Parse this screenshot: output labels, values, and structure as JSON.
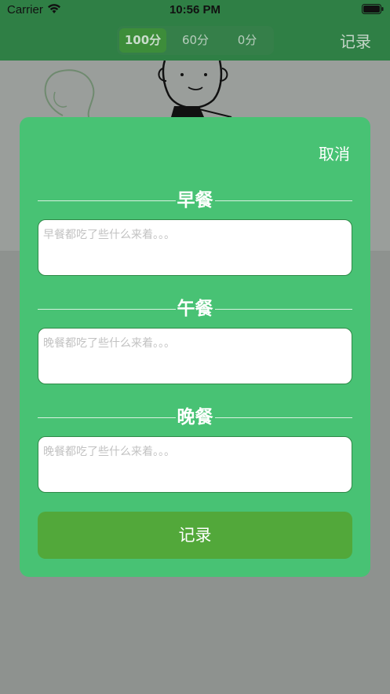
{
  "status_bar": {
    "carrier": "Carrier",
    "time": "10:56 PM",
    "icons": [
      "wifi-icon",
      "battery-icon"
    ]
  },
  "nav": {
    "segments": [
      {
        "label": "100分",
        "selected": true
      },
      {
        "label": "60分",
        "selected": false
      },
      {
        "label": "0分",
        "selected": false
      }
    ],
    "record_label": "记录"
  },
  "modal": {
    "cancel_label": "取消",
    "meals": [
      {
        "title": "早餐",
        "placeholder": "早餐都吃了些什么来着。。。",
        "value": ""
      },
      {
        "title": "午餐",
        "placeholder": "晚餐都吃了些什么来着。。。",
        "value": ""
      },
      {
        "title": "晚餐",
        "placeholder": "晚餐都吃了些什么来着。。。",
        "value": ""
      }
    ],
    "submit_label": "记录"
  },
  "colors": {
    "nav_bg": "#2f7f45",
    "modal_bg": "#48c274",
    "submit_bg": "#52a83a",
    "overlay": "#8e928f"
  }
}
